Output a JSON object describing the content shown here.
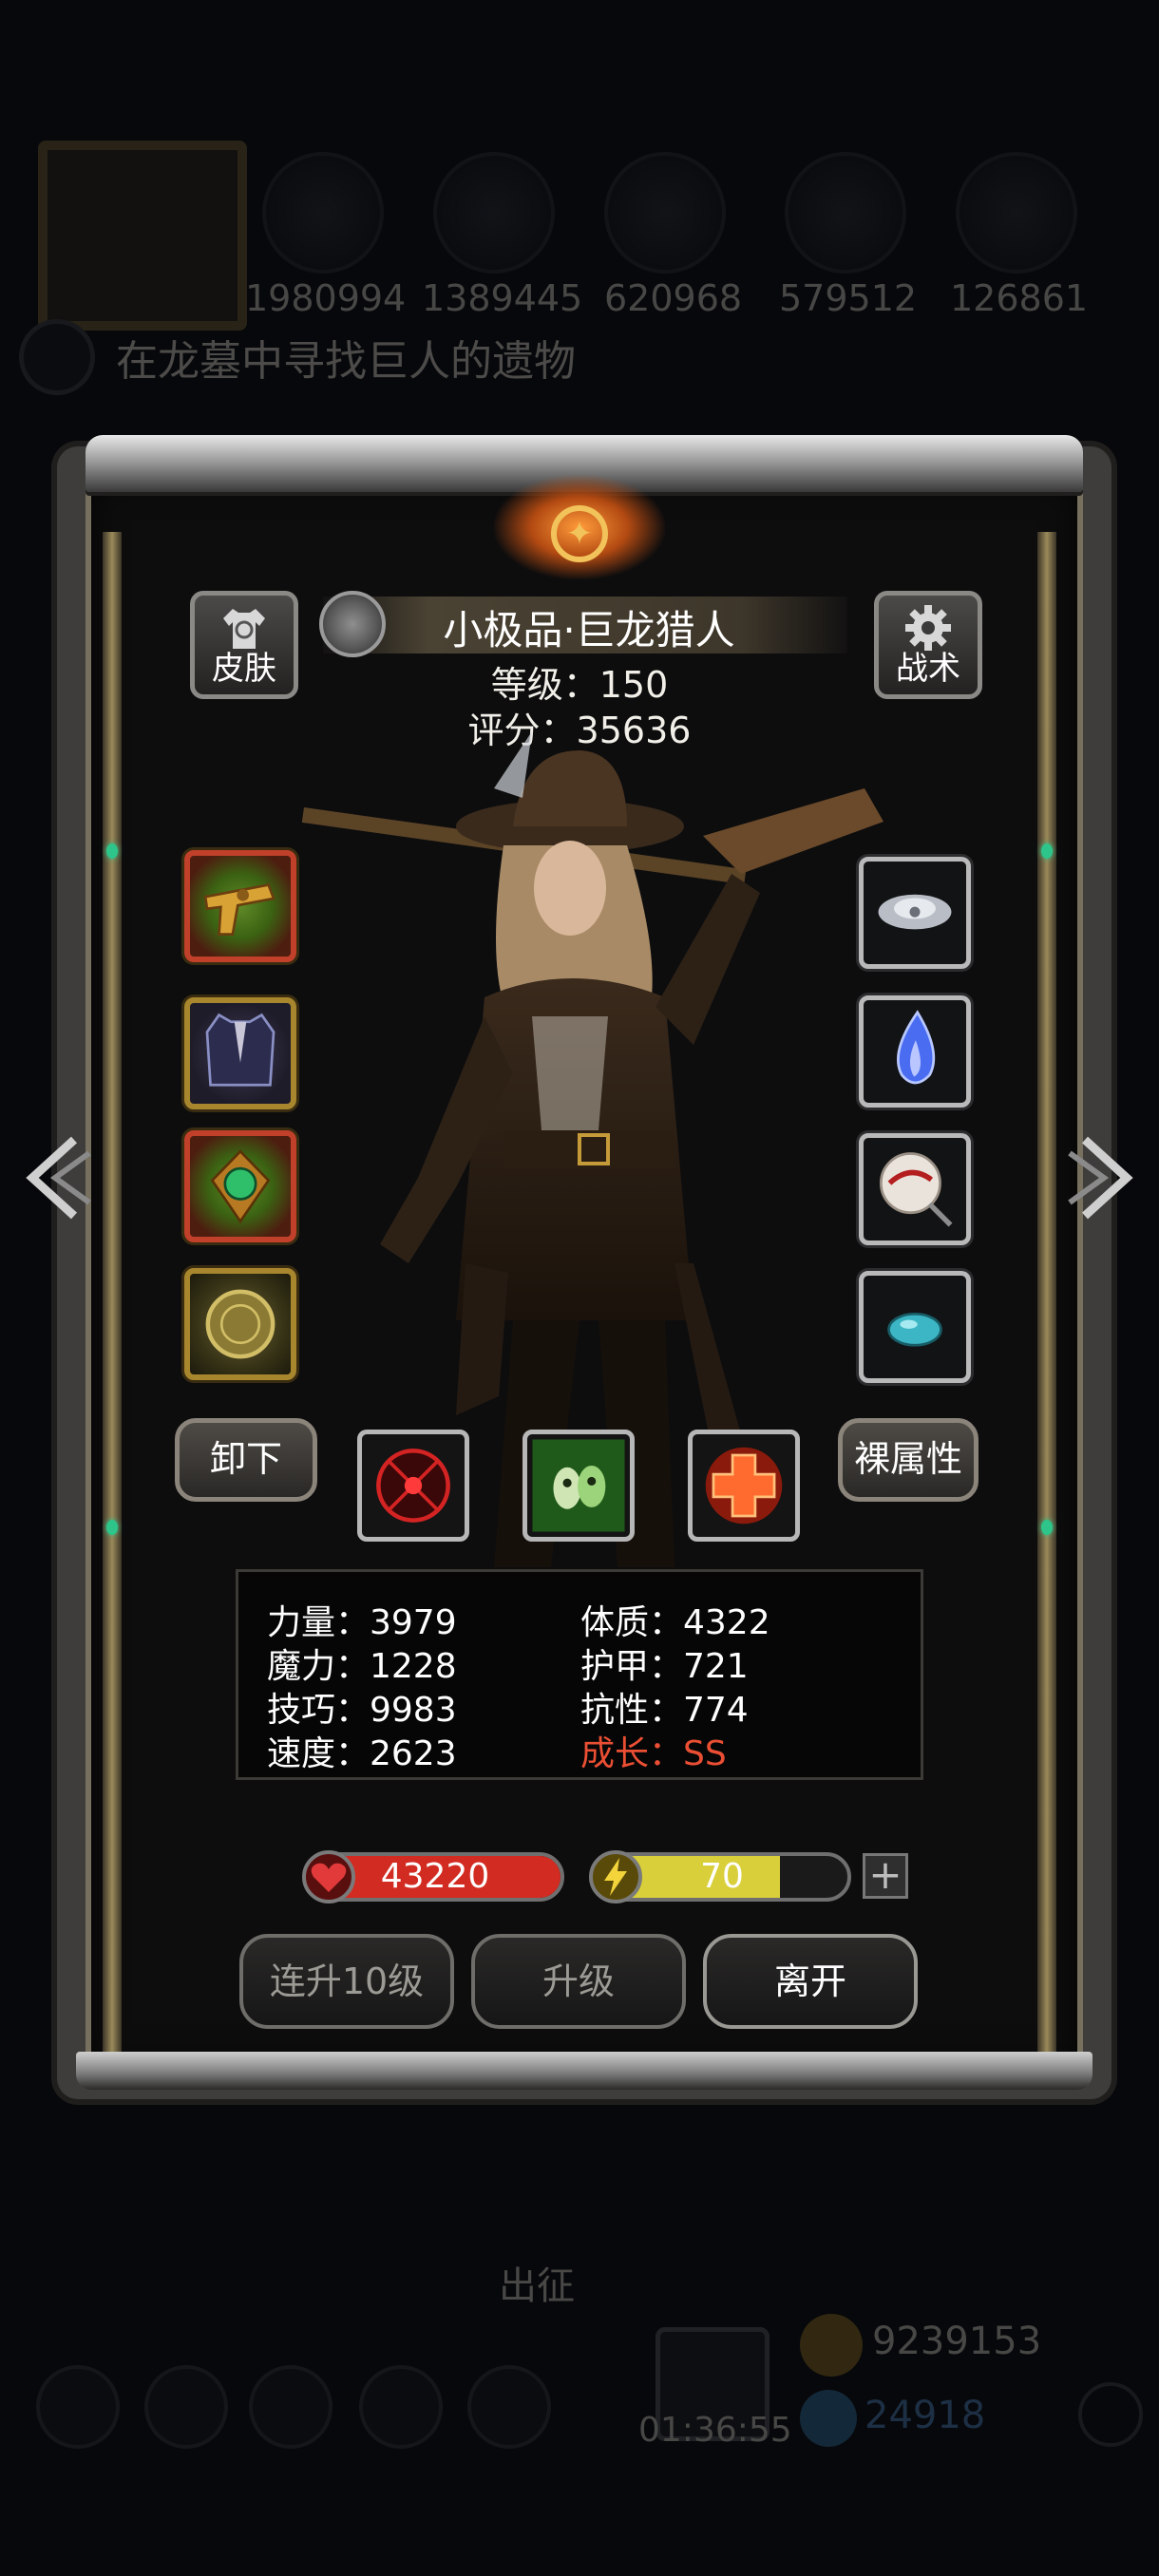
{
  "background": {
    "resources": [
      "1980994",
      "1389445",
      "620968",
      "579512",
      "126861"
    ],
    "quest": "在龙墓中寻找巨人的遗物",
    "deploy_label": "出征",
    "timer": "01:36:55",
    "gold": "9239153",
    "gems": "24918"
  },
  "hero": {
    "name": "小极品·巨龙猎人",
    "level_text": "等级：150",
    "score_text": "评分：35636"
  },
  "header": {
    "skin_label": "皮肤",
    "tactics_label": "战术"
  },
  "actions": {
    "unequip_label": "卸下",
    "base_attr_label": "裸属性"
  },
  "stats": {
    "strength": "力量：3979",
    "constitution": "体质：4322",
    "magic": "魔力：1228",
    "armor": "护甲：721",
    "skill": "技巧：9983",
    "resistance": "抗性：774",
    "speed": "速度：2623",
    "growth": "成长：SS"
  },
  "bars": {
    "hp": "43220",
    "energy": "70",
    "energy_fill": 0.73,
    "hp_color": "#d22b22",
    "energy_color": "#d9cf3a"
  },
  "buttons": {
    "level_up_10": "连升10级",
    "level_up": "升级",
    "leave": "离开"
  },
  "icons": {
    "left_slots": [
      "golden-pistol-icon",
      "dark-coat-icon",
      "emerald-brooch-icon",
      "gold-medallion-icon"
    ],
    "right_slots": [
      "cloud-rune-icon",
      "blue-flame-icon",
      "blood-fan-icon",
      "teal-stone-icon"
    ],
    "skills": [
      "red-target-icon",
      "green-mask-icon",
      "red-cross-icon"
    ]
  }
}
